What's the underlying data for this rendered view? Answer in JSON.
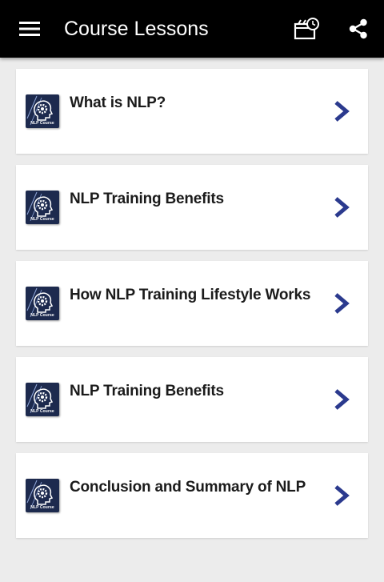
{
  "app_bar": {
    "title": "Course Lessons",
    "background": "#000000",
    "menu_icon": "hamburger-menu-icon",
    "actions": [
      {
        "name": "reminder",
        "icon": "calendar-clock-icon"
      },
      {
        "name": "share",
        "icon": "share-icon"
      }
    ]
  },
  "lessons": [
    {
      "title": "What is NLP?",
      "thumbnail_label": "NLP Course"
    },
    {
      "title": "NLP Training Benefits",
      "thumbnail_label": "NLP Course"
    },
    {
      "title": "How NLP Training Lifestyle Works",
      "thumbnail_label": "NLP Course"
    },
    {
      "title": "NLP Training Benefits",
      "thumbnail_label": "NLP Course"
    },
    {
      "title": "Conclusion and Summary of NLP",
      "thumbnail_label": "NLP Course"
    }
  ],
  "colors": {
    "page_background": "#ececec",
    "card_background": "#ffffff",
    "chevron": "#2b3a8e",
    "thumbnail_background": "#1d2a4e"
  }
}
